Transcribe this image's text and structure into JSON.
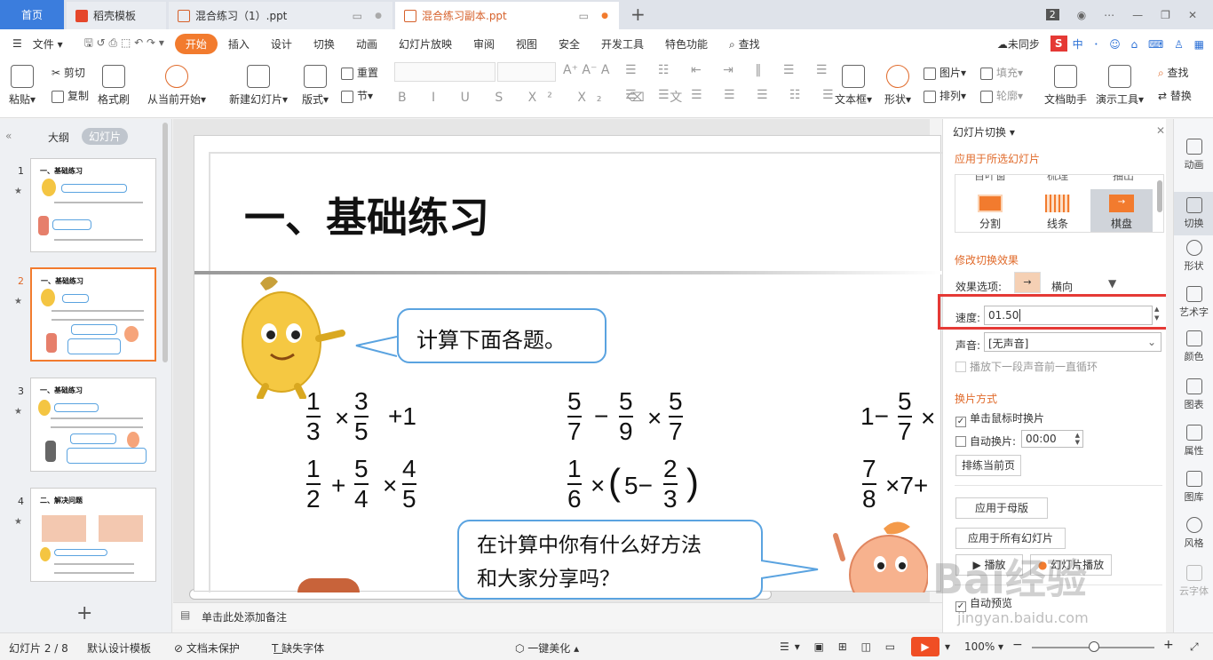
{
  "tabs": {
    "home": "首页",
    "templates": "稻壳模板",
    "doc1": "混合练习（1）.ppt",
    "doc2": "混合练习副本.ppt",
    "count_badge": "2"
  },
  "menu": {
    "file": "文件",
    "items": [
      "开始",
      "插入",
      "设计",
      "切换",
      "动画",
      "幻灯片放映",
      "审阅",
      "视图",
      "安全",
      "开发工具",
      "特色功能"
    ],
    "search": "查找",
    "sync": "未同步"
  },
  "ribbon": {
    "paste": "粘贴",
    "cut": "剪切",
    "copy": "复制",
    "format_painter": "格式刷",
    "from_current": "从当前开始",
    "new_slide": "新建幻灯片",
    "layout": "版式",
    "reset": "重置",
    "section": "节",
    "textbox": "文本框",
    "shape": "形状",
    "picture": "图片",
    "arrange": "排列",
    "fill": "填充",
    "outline": "轮廓",
    "doc_helper": "文档助手",
    "present_tools": "演示工具",
    "find": "查找",
    "replace": "替换"
  },
  "left_panel": {
    "outline_tab": "大纲",
    "slides_tab": "幻灯片",
    "thumbs": [
      {
        "num": "1",
        "title": "一、基础练习"
      },
      {
        "num": "2",
        "title": "一、基础练习"
      },
      {
        "num": "3",
        "title": "一、基础练习"
      },
      {
        "num": "4",
        "title": "二、解决问题"
      }
    ]
  },
  "slide": {
    "title": "一、基础练习",
    "bubble1": "计算下面各题。",
    "bubble2_line1": "在计算中你有什么好方法",
    "bubble2_line2": "和大家分享吗？",
    "row1": {
      "a": {
        "f1n": "1",
        "f1d": "3",
        "op1": "×",
        "f2n": "3",
        "f2d": "5",
        "tail": "+1"
      },
      "b": {
        "f1n": "5",
        "f1d": "7",
        "op1": "−",
        "f2n": "5",
        "f2d": "9",
        "op2": "×",
        "f3n": "5",
        "f3d": "7"
      },
      "c": {
        "lead": "1−",
        "f1n": "5",
        "f1d": "7",
        "op1": "×"
      }
    },
    "row2": {
      "a": {
        "f1n": "1",
        "f1d": "2",
        "op1": "+",
        "f2n": "5",
        "f2d": "4",
        "op2": "×",
        "f3n": "4",
        "f3d": "5"
      },
      "b": {
        "f1n": "1",
        "f1d": "6",
        "op1": "×",
        "open": "(",
        "mid": "5−",
        "f2n": "2",
        "f2d": "3",
        "close": ")"
      },
      "c": {
        "f1n": "7",
        "f1d": "8",
        "tail": "×7+"
      }
    }
  },
  "right_panel": {
    "title": "幻灯片切换",
    "apply_selected": "应用于所选幻灯片",
    "effects": [
      {
        "top": "百叶窗",
        "name": "分割"
      },
      {
        "top": "梳理",
        "name": "线条"
      },
      {
        "top": "抽出",
        "name": "棋盘"
      }
    ],
    "modify_effect": "修改切换效果",
    "effect_option_label": "效果选项:",
    "effect_option_value": "横向",
    "speed_label": "速度:",
    "speed_value": "01.50",
    "sound_label": "声音:",
    "sound_value": "[无声音]",
    "loop_label": "播放下一段声音前一直循环",
    "advance_header": "换片方式",
    "on_click_label": "单击鼠标时换片",
    "auto_label": "自动换片:",
    "auto_value": "00:00",
    "rehearse": "排练当前页",
    "apply_master": "应用于母版",
    "apply_all": "应用于所有幻灯片",
    "play": "播放",
    "slideshow": "幻灯片播放",
    "auto_preview": "自动预览"
  },
  "sidebar": [
    "动画",
    "切换",
    "形状",
    "艺术字",
    "颜色",
    "图表",
    "属性",
    "图库",
    "风格",
    "云字体"
  ],
  "notes": "单击此处添加备注",
  "status": {
    "slide_pos": "幻灯片 2 / 8",
    "template": "默认设计模板",
    "protect": "文档未保护",
    "missing_font": "缺失字体",
    "beautify": "一键美化",
    "zoom": "100%"
  },
  "watermark": {
    "main": "Bai经验",
    "sub": "jingyan.baidu.com"
  },
  "colors": {
    "accent": "#f27b2e",
    "tab_blue": "#3b7ddd",
    "highlight_box": "#e53935",
    "section_orange": "#e06a2a"
  }
}
